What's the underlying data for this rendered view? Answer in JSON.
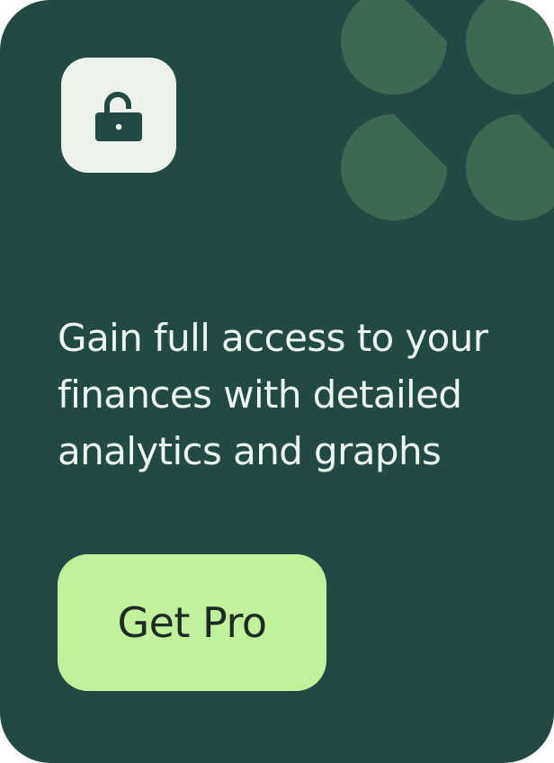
{
  "colors": {
    "card_background": "#214a44",
    "decor_shape": "#3b6a53",
    "icon_tile_background": "#ecf2e9",
    "icon_glyph": "#214a44",
    "headline_text": "#eef4ee",
    "cta_background": "#bff29a",
    "cta_text": "#1f2a24"
  },
  "icons": {
    "lock": "unlocked-padlock-icon"
  },
  "promo": {
    "headline": "Gain full access to your finances with detailed analytics and graphs",
    "cta_label": "Get Pro"
  }
}
